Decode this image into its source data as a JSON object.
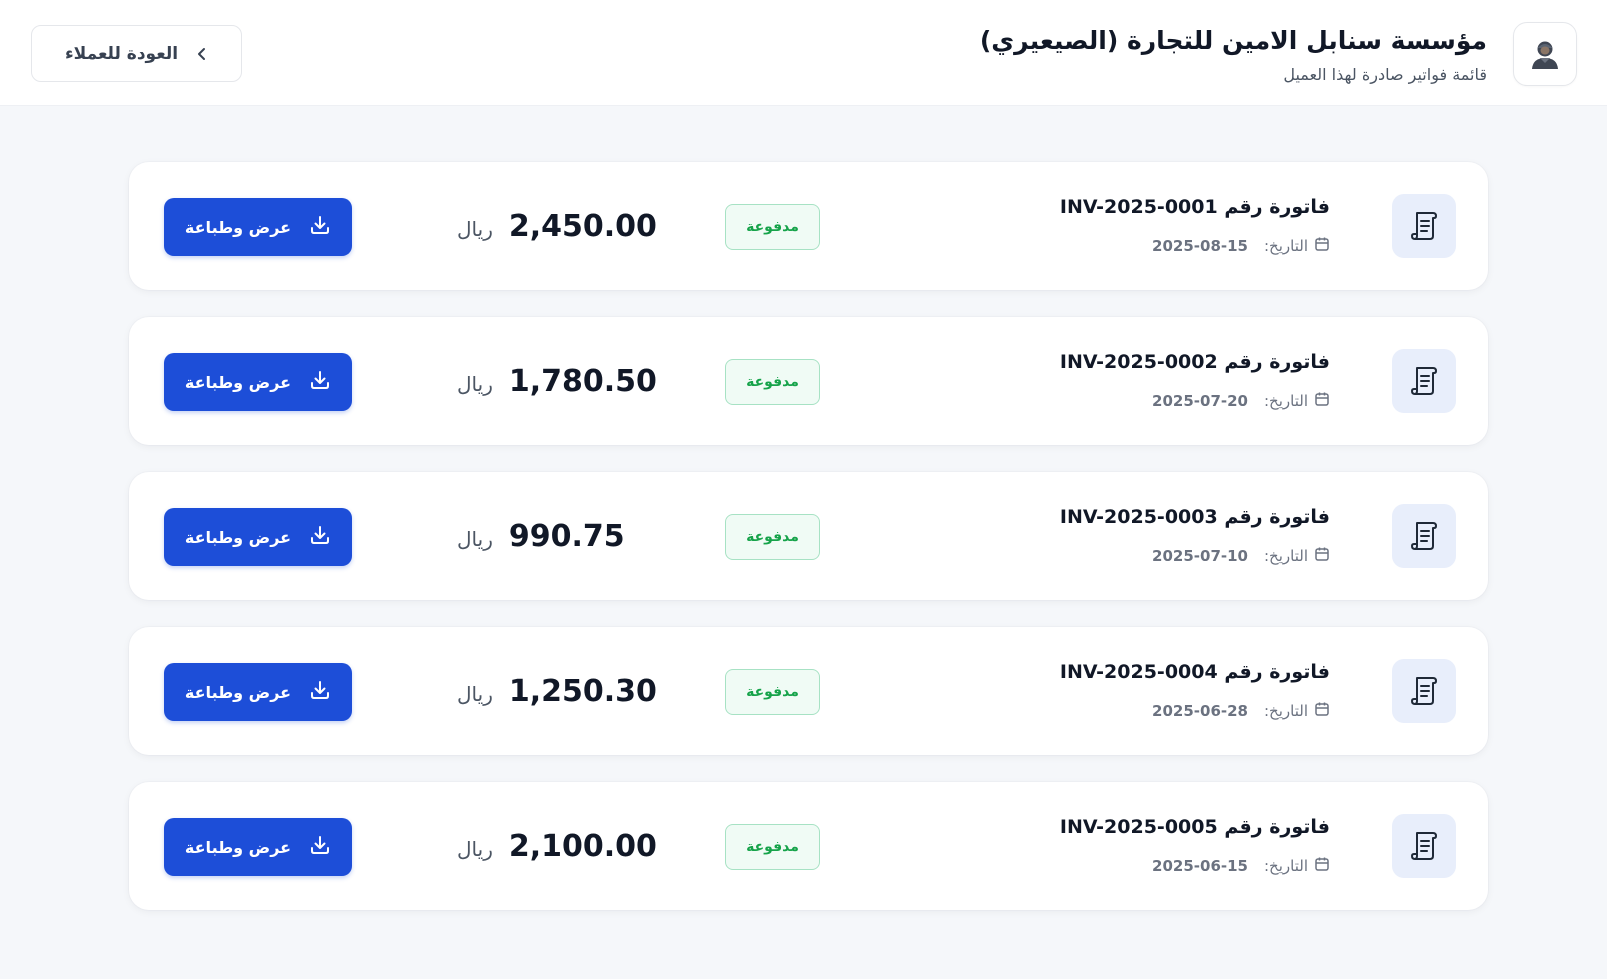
{
  "header": {
    "client_name": "مؤسسة سنابل الامين للتجارة (الصيعيري)",
    "subtitle": "قائمة فواتير صادرة لهذا العميل",
    "back_label": "العودة للعملاء",
    "avatar_icon": "user-icon",
    "back_icon": "chevron-left-icon"
  },
  "labels": {
    "date_label": "التاريخ:",
    "currency": "ريال",
    "print_label": "عرض وطباعة"
  },
  "colors": {
    "primary": "#1d4ed8",
    "paid": "#16a34a",
    "icon_bg": "#e8eefb"
  },
  "invoices": [
    {
      "title": "فاتورة رقم INV-2025-0001",
      "date": "2025-08-15",
      "status": "مدفوعة",
      "amount": "2,450.00"
    },
    {
      "title": "فاتورة رقم INV-2025-0002",
      "date": "2025-07-20",
      "status": "مدفوعة",
      "amount": "1,780.50"
    },
    {
      "title": "فاتورة رقم INV-2025-0003",
      "date": "2025-07-10",
      "status": "مدفوعة",
      "amount": "990.75"
    },
    {
      "title": "فاتورة رقم INV-2025-0004",
      "date": "2025-06-28",
      "status": "مدفوعة",
      "amount": "1,250.30"
    },
    {
      "title": "فاتورة رقم INV-2025-0005",
      "date": "2025-06-15",
      "status": "مدفوعة",
      "amount": "2,100.00"
    }
  ]
}
